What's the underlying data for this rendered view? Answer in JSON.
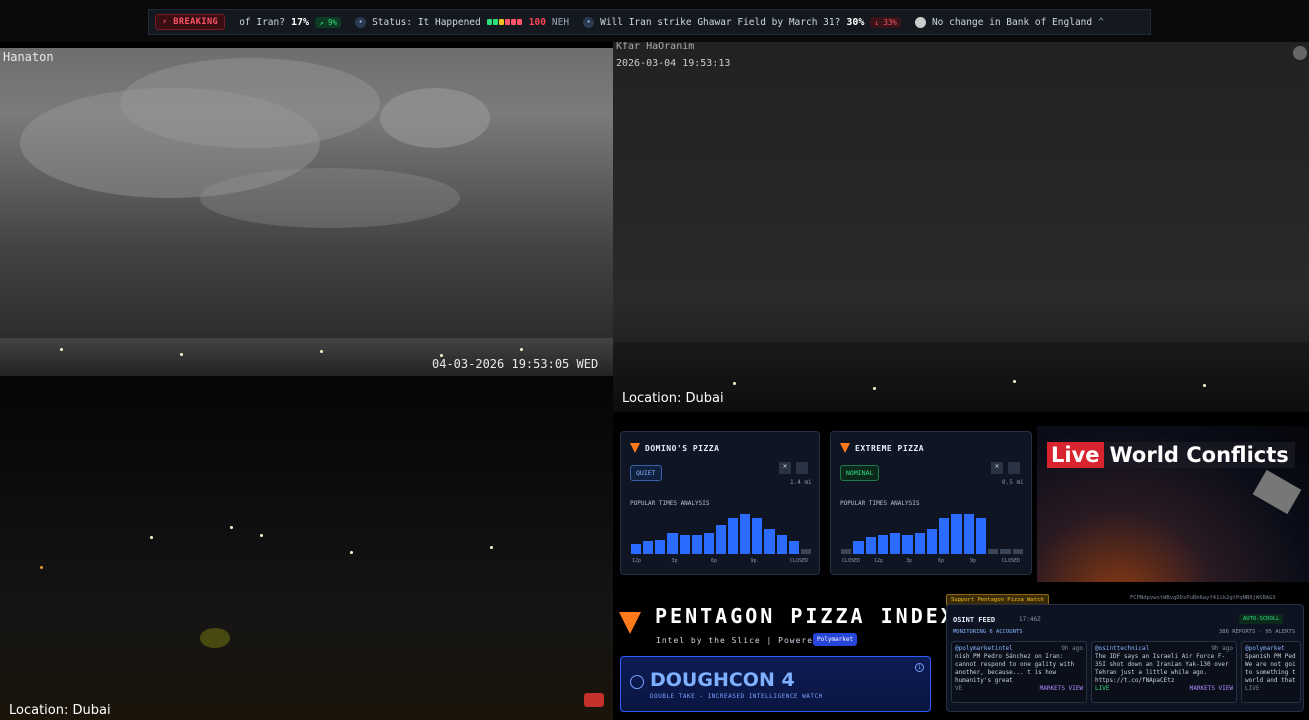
{
  "ticker": {
    "breaking": "⚡ BREAKING",
    "items": [
      {
        "text": "of Iran?",
        "pct": "17%",
        "delta": "↗ 9%"
      },
      {
        "text": "Status: It Happened",
        "value": "100",
        "tag": "NEH"
      },
      {
        "text": "Will Iran strike Ghawar Field by March 31?",
        "pct": "30%",
        "delta": "↓ 33%"
      },
      {
        "text": "No change in Bank of England"
      }
    ],
    "more": "^"
  },
  "cams": {
    "top_left": {
      "label": "Hanaton",
      "timestamp": "04-03-2026 19:53:05 WED"
    },
    "top_right": {
      "label": "Kfar HaOranim",
      "timestamp": "2026-03-04 19:53:13",
      "location": "Location: Dubai"
    },
    "bottom_left": {
      "location": "Location: Dubai"
    }
  },
  "pizza": {
    "dominos": {
      "name": "DOMINO'S PIZZA",
      "status": "QUIET",
      "dist": "1.4 mi",
      "section": "POPULAR TIMES ANALYSIS",
      "ticks": [
        "12p",
        "3p",
        "6p",
        "9p",
        "CLOSED"
      ],
      "values": [
        10,
        12,
        13,
        20,
        18,
        18,
        20,
        28,
        34,
        38,
        34,
        24,
        18,
        12,
        5
      ],
      "active": [
        true,
        true,
        true,
        true,
        true,
        true,
        true,
        true,
        true,
        true,
        true,
        true,
        true,
        true,
        false
      ]
    },
    "extreme": {
      "name": "EXTREME PIZZA",
      "status": "NOMINAL",
      "dist": "0.5 mi",
      "section": "POPULAR TIMES ANALYSIS",
      "ticks": [
        "CLOSED",
        "12p",
        "3p",
        "6p",
        "9p",
        "CLOSED"
      ],
      "values": [
        5,
        12,
        16,
        18,
        20,
        18,
        20,
        24,
        34,
        38,
        38,
        34,
        5,
        5,
        5
      ],
      "active": [
        false,
        true,
        true,
        true,
        true,
        true,
        true,
        true,
        true,
        true,
        true,
        true,
        false,
        false,
        false
      ]
    },
    "index_title": "PENTAGON PIZZA INDEX",
    "subtitle": "Intel by the Slice | Powered by",
    "powered": "Polymarket",
    "doughcon": "DOUGHCON 4",
    "doughcon_sub": "DOUBLE TAKE - INCREASED INTELLIGENCE WATCH",
    "support": "Support Pentagon Pizza Watch",
    "wallet": "FCPNdpvwxtW8vgDDsPuBb6wyf41ik2gtPqNN9jWSBAGS"
  },
  "live": {
    "live": "Live",
    "title": "World Conflicts"
  },
  "osint": {
    "title": "OSINT FEED",
    "time": "17:46Z",
    "monitoring": "MONITORING 6 ACCOUNTS",
    "autoscroll": "AUTO-SCROLL",
    "stats": "386 REPORTS · 95 ALERTS",
    "posts": [
      {
        "handle": "@polymarketintel",
        "ago": "9h ago",
        "text": "nish PM Pedro Sánchez on Iran: cannot respond to one gality with another, because... t is how humanity's great",
        "foot": "VE",
        "links": "MARKETS  VIEW"
      },
      {
        "handle": "@osinttechnical",
        "ago": "9h ago",
        "text": "The IDF says an Israeli Air Force F-35I shot down an Iranian Yak-130 over Tehran just a little while ago. https://t.co/fNApaCEtz",
        "foot": "LIVE",
        "links": "MARKETS  VIEW"
      },
      {
        "handle": "@polymarket",
        "ago": "",
        "text": "Spanish PM Ped We are not goi to something t world and that",
        "foot": "LIVE",
        "links": ""
      }
    ]
  }
}
